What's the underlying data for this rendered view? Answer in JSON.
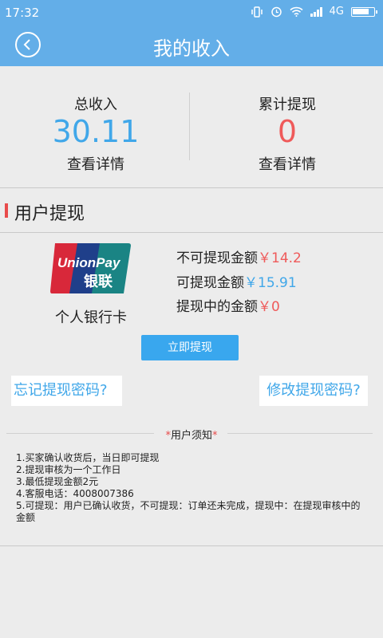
{
  "status_bar": {
    "time": "17:32",
    "network": "4G",
    "battery_level": 0.8
  },
  "nav": {
    "title": "我的收入"
  },
  "income": {
    "total_label": "总收入",
    "total_value": "30.11",
    "total_detail": "查看详情",
    "withdrawn_label": "累计提现",
    "withdrawn_value": "0",
    "withdrawn_detail": "查看详情"
  },
  "section": {
    "title": "用户提现"
  },
  "bank": {
    "card_label": "个人银行卡",
    "logo_text_en": "UnionPay",
    "logo_text_cn": "银联"
  },
  "amounts": {
    "non_withdrawable_label": "不可提现金额",
    "non_withdrawable_value": "￥14.2",
    "withdrawable_label": "可提现金额",
    "withdrawable_value": "￥15.91",
    "withdrawing_label": "提现中的金额",
    "withdrawing_value": "￥0"
  },
  "actions": {
    "withdraw_button": "立即提现",
    "forgot_password": "忘记提现密码?",
    "change_password": "修改提现密码?"
  },
  "notice": {
    "star": "*",
    "title": "用户须知",
    "items": [
      "1.买家确认收货后，当日即可提现",
      "2.提现审核为一个工作日",
      "3.最低提现金额2元",
      "4.客服电话：4008007386",
      "5.可提现：用户已确认收货，不可提现：订单还未完成，提现中：在提现审核中的金额"
    ]
  },
  "colors": {
    "header": "#63aee8",
    "accent_blue": "#40a7e9",
    "accent_red": "#ef5a5a",
    "button": "#39a7ee"
  }
}
